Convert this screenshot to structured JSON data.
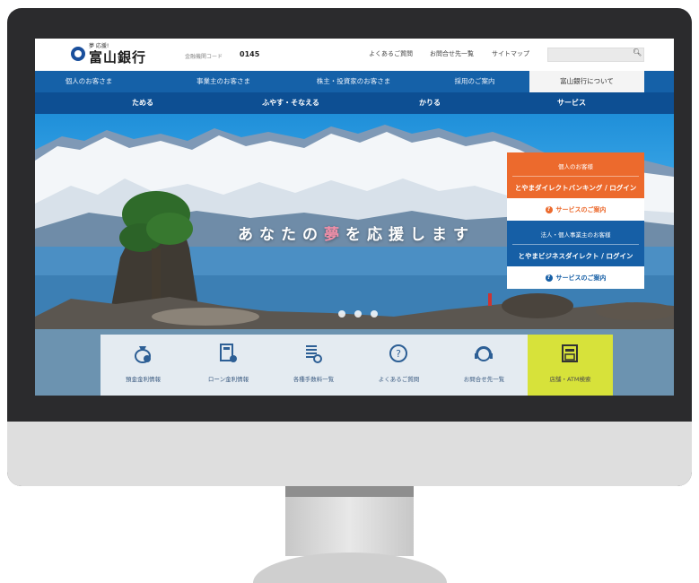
{
  "header": {
    "logo_small": "夢 応援!",
    "logo_text": "富山銀行",
    "bankcode_label": "金融機関コード",
    "bankcode": "0145",
    "links": [
      "よくあるご質問",
      "お問合せ先一覧",
      "サイトマップ"
    ]
  },
  "nav_main": [
    "個人のお客さま",
    "事業主のお客さま",
    "株主・投資家のお客さま",
    "採用のご案内",
    "富山銀行について"
  ],
  "nav_sub": [
    "ためる",
    "ふやす・そなえる",
    "かりる",
    "サービス"
  ],
  "hero": {
    "tagline_pre": "あなたの",
    "tagline_hl": "夢",
    "tagline_post": "を応援します"
  },
  "login_panel": {
    "personal_title": "個人のお客様",
    "personal_login": "とやまダイレクトバンキング / ログイン",
    "personal_service": "サービスのご案内",
    "corp_title": "法人・個人事業主のお客様",
    "corp_login": "とやまビジネスダイレクト / ログイン",
    "corp_service": "サービスのご案内"
  },
  "quick_links": [
    "預金金利情報",
    "ローン金利情報",
    "各種手数料一覧",
    "よくあるご質問",
    "お問合せ先一覧",
    "店舗・ATM検索"
  ],
  "colors": {
    "nav_blue": "#1561a8",
    "nav_dark": "#0d4f93",
    "orange": "#ec6a2d",
    "highlight_yellow": "#d7e23a"
  }
}
